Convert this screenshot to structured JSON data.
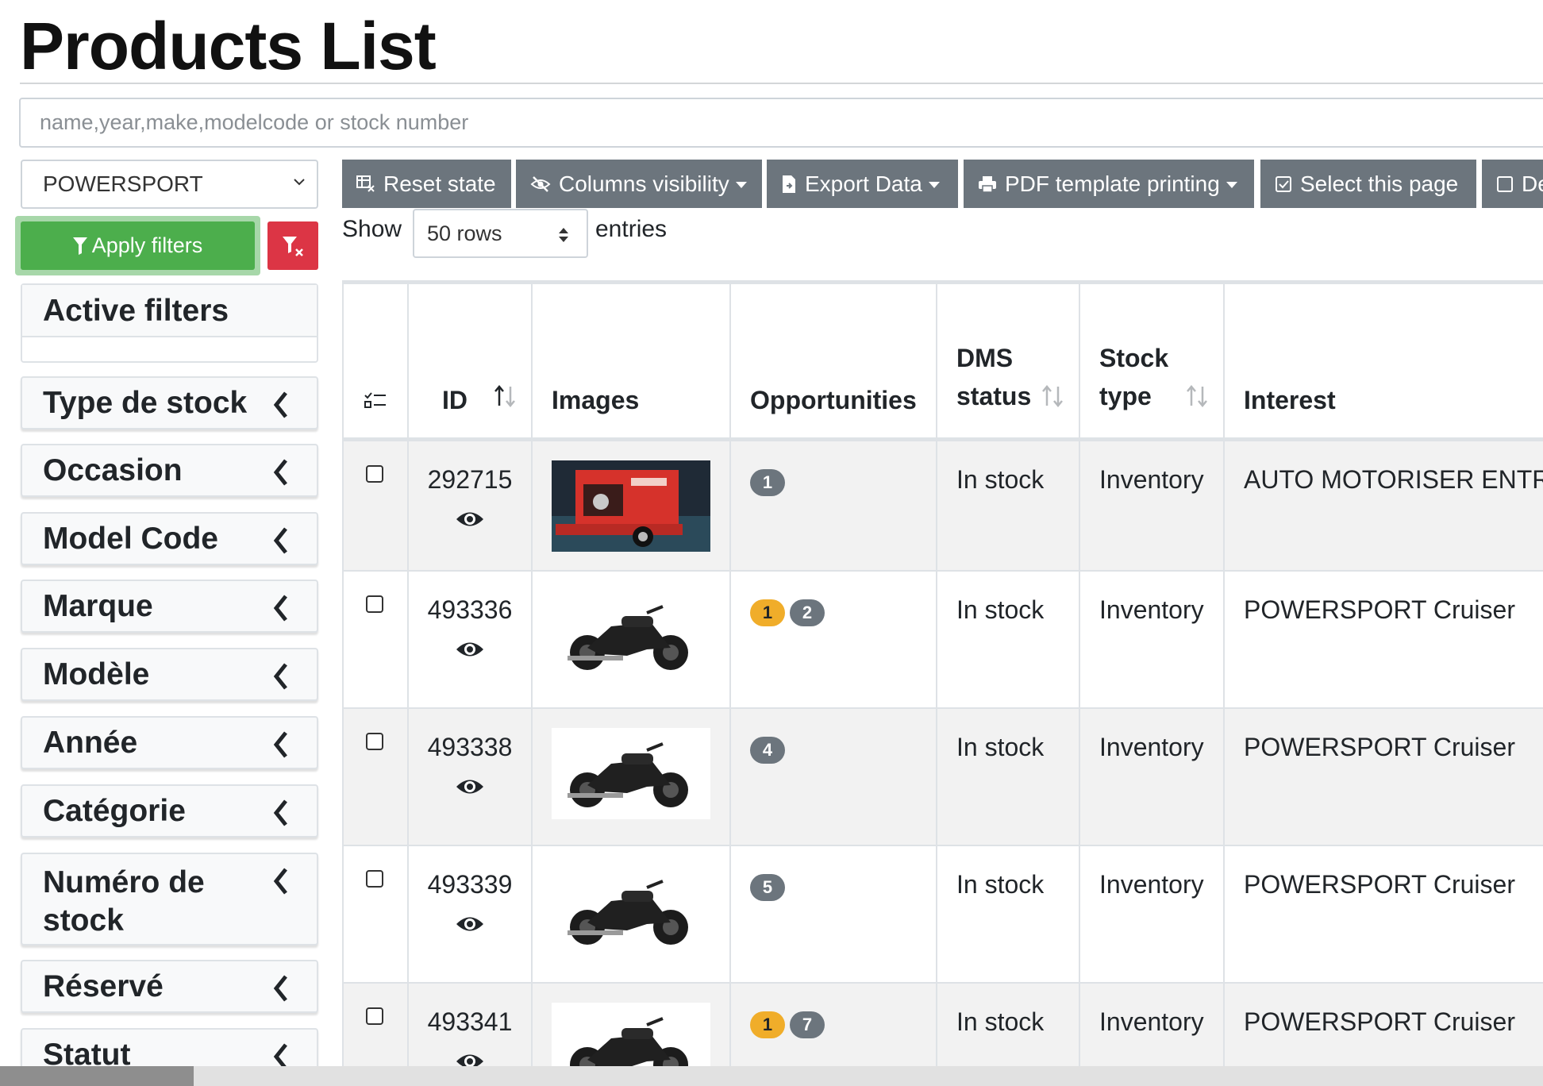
{
  "page": {
    "title": "Products List"
  },
  "search": {
    "placeholder": "name,year,make,modelcode or stock number"
  },
  "category_select": {
    "value": "POWERSPORT"
  },
  "filters": {
    "apply_label": "Apply filters",
    "active_title": "Active filters",
    "groups": [
      "Type de stock",
      "Occasion",
      "Model Code",
      "Marque",
      "Modèle",
      "Année",
      "Catégorie",
      "Numéro de stock",
      "Réservé",
      "Statut"
    ]
  },
  "toolbar": {
    "reset": "Reset state",
    "columns": "Columns visibility",
    "export": "Export Data",
    "pdf": "PDF template printing",
    "select_page": "Select this page",
    "deselect": "De"
  },
  "length": {
    "show": "Show",
    "value": "50 rows",
    "entries": "entries"
  },
  "table": {
    "headers": {
      "id": "ID",
      "images": "Images",
      "opportunities": "Opportunities",
      "dms_status_1": "DMS",
      "dms_status_2": "status",
      "stock_type_1": "Stock",
      "stock_type_2": "type",
      "interest": "Interest"
    },
    "rows": [
      {
        "id": "292715",
        "image": "red-trailer",
        "opportunities": [
          {
            "n": "1",
            "style": "secondary"
          }
        ],
        "dms_status": "In stock",
        "stock_type": "Inventory",
        "interest": "AUTO MOTORISER ENTR"
      },
      {
        "id": "493336",
        "image": "black-motorcycle",
        "opportunities": [
          {
            "n": "1",
            "style": "warning"
          },
          {
            "n": "2",
            "style": "secondary"
          }
        ],
        "dms_status": "In stock",
        "stock_type": "Inventory",
        "interest": "POWERSPORT Cruiser"
      },
      {
        "id": "493338",
        "image": "black-motorcycle",
        "opportunities": [
          {
            "n": "4",
            "style": "secondary"
          }
        ],
        "dms_status": "In stock",
        "stock_type": "Inventory",
        "interest": "POWERSPORT Cruiser"
      },
      {
        "id": "493339",
        "image": "black-motorcycle",
        "opportunities": [
          {
            "n": "5",
            "style": "secondary"
          }
        ],
        "dms_status": "In stock",
        "stock_type": "Inventory",
        "interest": "POWERSPORT Cruiser"
      },
      {
        "id": "493341",
        "image": "black-motorcycle",
        "opportunities": [
          {
            "n": "1",
            "style": "warning"
          },
          {
            "n": "7",
            "style": "secondary"
          }
        ],
        "dms_status": "In stock",
        "stock_type": "Inventory",
        "interest": "POWERSPORT Cruiser"
      }
    ]
  },
  "colors": {
    "apply": "#4cae4c",
    "clear": "#dc3545",
    "toolbar": "#6c757d",
    "badge_warning": "#f0ad2a",
    "badge_secondary": "#6c757d"
  }
}
